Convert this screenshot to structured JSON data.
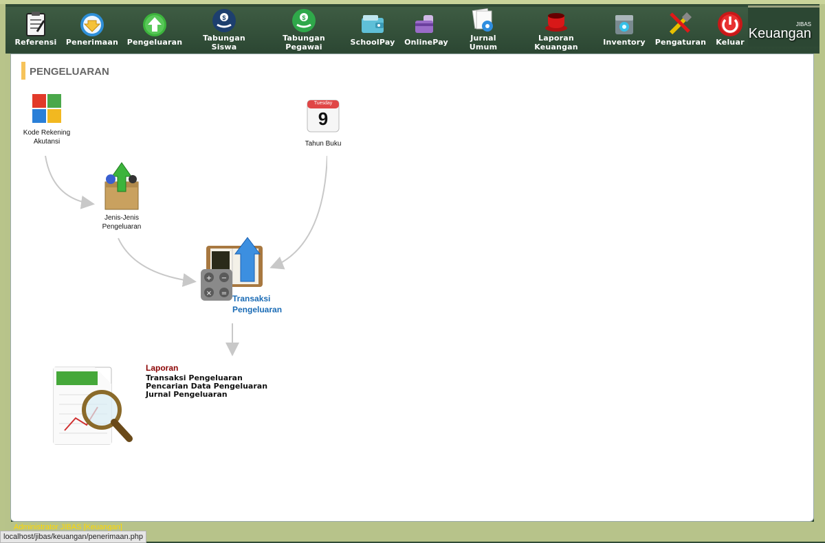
{
  "app": {
    "brand_small": "JIBAS",
    "brand_name": "Keuangan"
  },
  "toolbar": {
    "items": [
      {
        "label": "Referensi",
        "icon": "clipboard-icon"
      },
      {
        "label": "Penerimaan",
        "icon": "arrow-down-icon"
      },
      {
        "label": "Pengeluaran",
        "icon": "arrow-up-icon"
      },
      {
        "label_line1": "Tabungan",
        "label_line2": "Siswa",
        "icon": "money-hand-icon"
      },
      {
        "label_line1": "Tabungan",
        "label_line2": "Pegawai",
        "icon": "money-hand-icon"
      },
      {
        "label": "SchoolPay",
        "icon": "wallet-icon"
      },
      {
        "label": "OnlinePay",
        "icon": "card-icon"
      },
      {
        "label_line1": "Jurnal",
        "label_line2": "Umum",
        "icon": "journal-icon"
      },
      {
        "label_line1": "Laporan",
        "label_line2": "Keuangan",
        "icon": "cup-icon"
      },
      {
        "label": "Inventory",
        "icon": "inventory-icon"
      },
      {
        "label": "Pengaturan",
        "icon": "tools-icon"
      },
      {
        "label": "Keluar",
        "icon": "power-icon"
      }
    ]
  },
  "page": {
    "title": "PENGELUARAN",
    "nodes": {
      "kode_rekening": "Kode Rekening\nAkutansi",
      "tahun_buku": "Tahun Buku",
      "calendar_day": "Tuesday",
      "calendar_date": "9",
      "jenis": "Jenis-Jenis\nPengeluaran",
      "transaksi": "Transaksi\nPengeluaran"
    },
    "report": {
      "title": "Laporan",
      "links": [
        "Transaksi Pengeluaran",
        "Pencarian Data Pengeluaran",
        "Jurnal Pengeluaran"
      ]
    }
  },
  "status": {
    "user": "Administrator JIBAS [Keuangan]",
    "url": "localhost/jibas/keuangan/penerimaan.php"
  }
}
